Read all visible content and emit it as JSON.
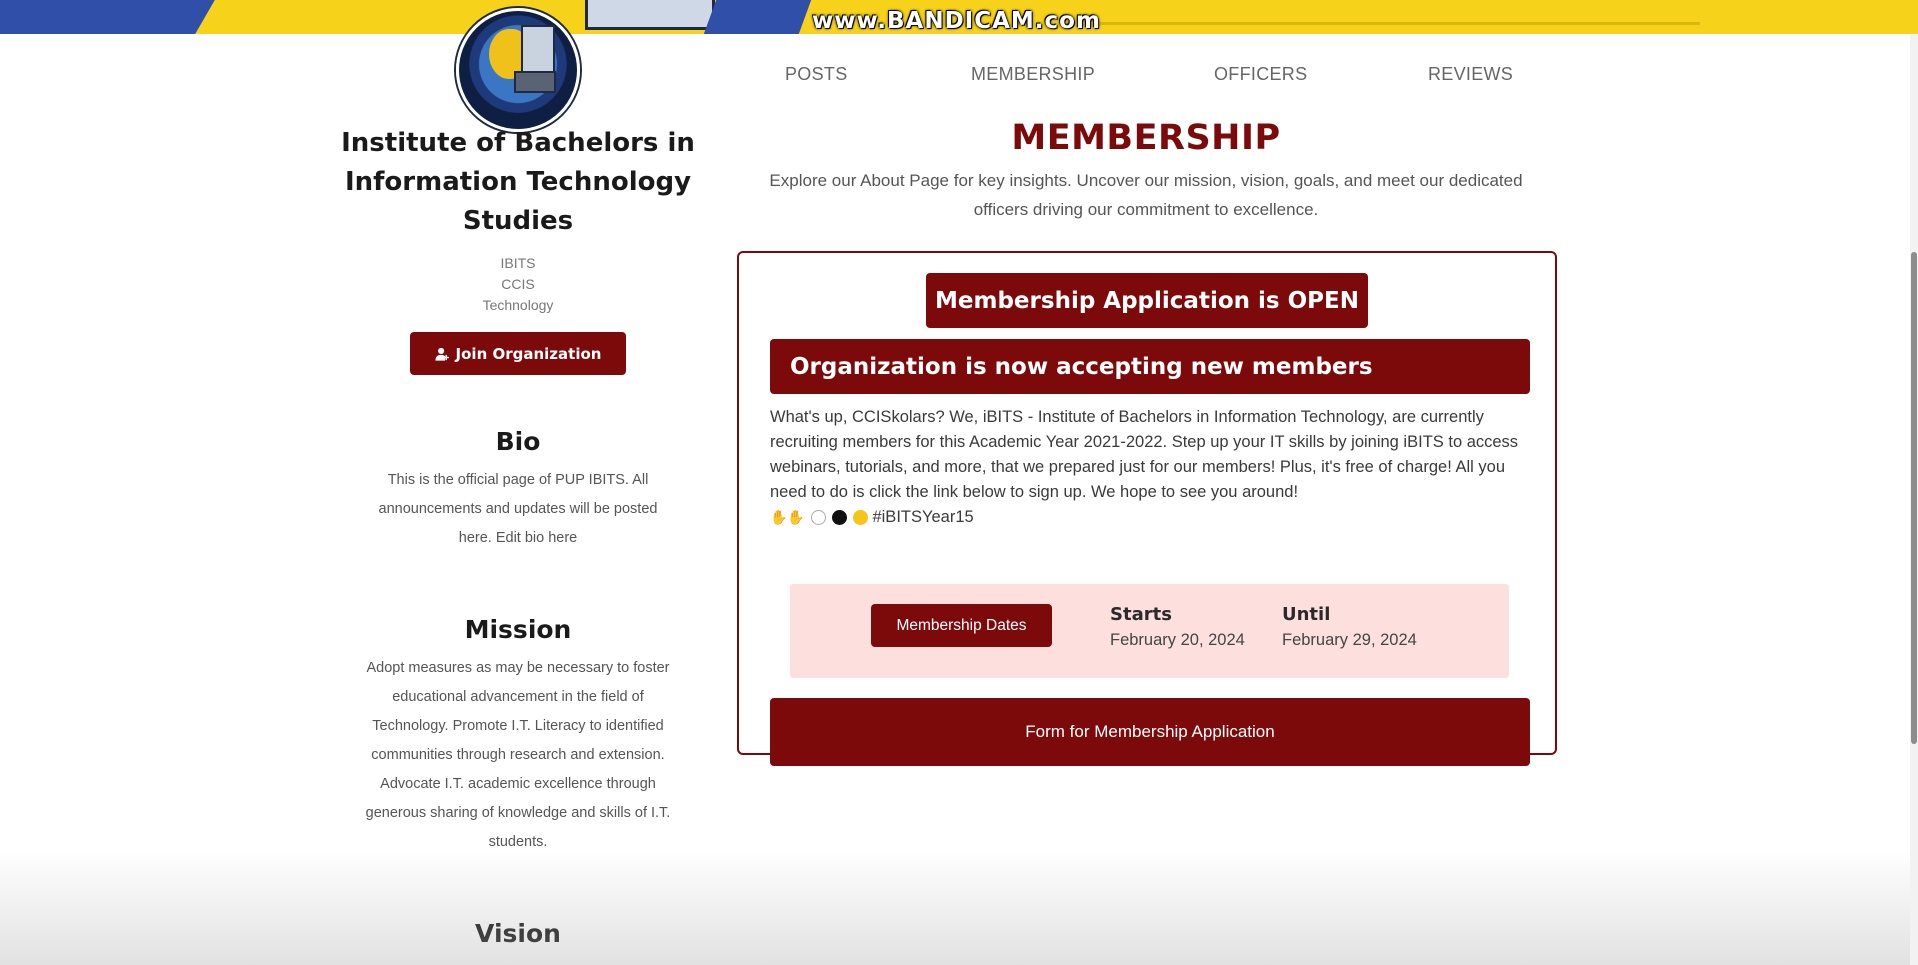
{
  "watermark": "www.BANDICAM.com",
  "nav": {
    "posts": "POSTS",
    "membership": "MEMBERSHIP",
    "officers": "OFFICERS",
    "reviews": "REVIEWS"
  },
  "sidebar": {
    "title_line1": "Institute of Bachelors in",
    "title_line2": "Information Technology",
    "title_line3": "Studies",
    "tags": [
      "IBITS",
      "CCIS",
      "Technology"
    ],
    "join_button": "Join Organization",
    "bio_heading": "Bio",
    "bio_line1": "This is the official page of PUP IBITS. All",
    "bio_line2": "announcements and updates will be posted",
    "bio_line3": "here. Edit bio here",
    "mission_heading": "Mission",
    "mission_lines": [
      "Adopt measures as may be necessary to foster",
      "educational advancement in the field of",
      "Technology. Promote I.T. Literacy to identified",
      "communities through research and extension.",
      "Advocate I.T. academic excellence through",
      "generous sharing of knowledge and skills of I.T.",
      "students."
    ],
    "vision_heading": "Vision"
  },
  "main": {
    "heading": "MEMBERSHIP",
    "sub_line1": "Explore our About Page for key insights. Uncover our mission, vision, goals, and meet our dedicated",
    "sub_line2": "officers driving our commitment to excellence.",
    "open_badge": "Membership Application is OPEN",
    "accepting_banner": "Organization is now accepting new members",
    "message": "What's up, CCISkolars? We, iBITS - Institute of Bachelors in Information Technology, are currently recruiting members for this Academic Year 2021-2022. Step up your IT skills by joining iBITS to access webinars, tutorials, and more, that we prepared just for our members! Plus, it's free of charge! All you need to do is click the link below to sign up. We hope to see you around!",
    "hashtag": "#iBITSYear15",
    "dates_button": "Membership Dates",
    "starts_label": "Starts",
    "starts_value": "February 20, 2024",
    "until_label": "Until",
    "until_value": "February 29, 2024",
    "form_button": "Form for Membership Application"
  },
  "colors": {
    "brand": "#7d0a0a",
    "dates_background": "#fde0de",
    "banner_yellow": "#f6d21a"
  }
}
